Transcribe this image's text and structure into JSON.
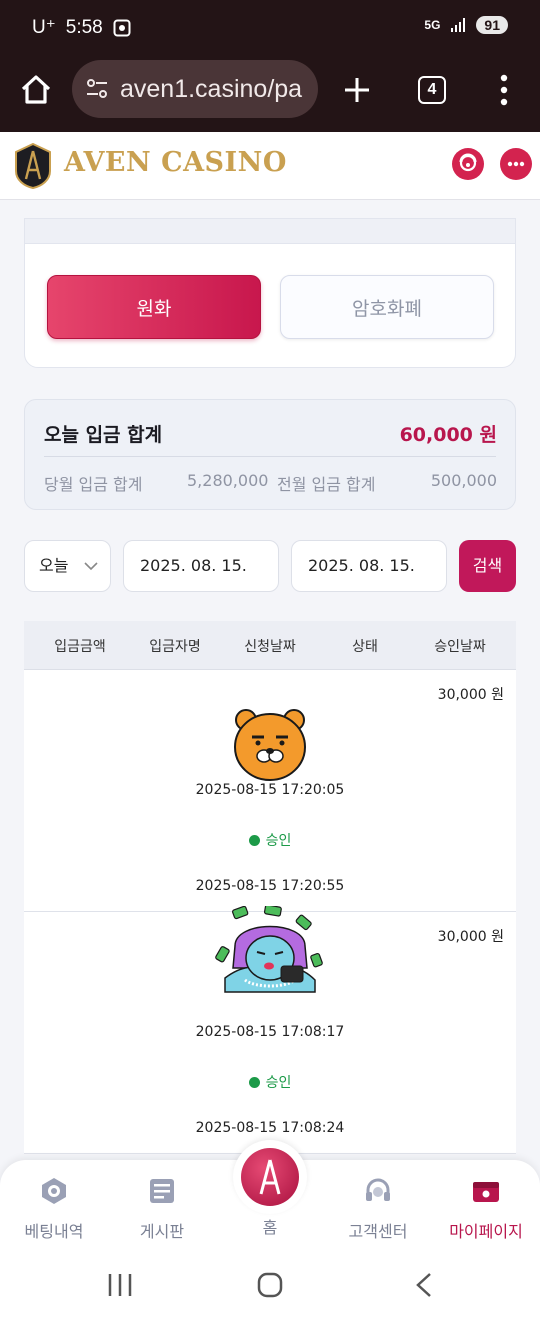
{
  "status_bar": {
    "carrier": "U⁺",
    "time": "5:58",
    "network": "5G",
    "battery": "91"
  },
  "browser": {
    "url": "aven1.casino/pa",
    "tab_count": "4"
  },
  "header": {
    "logo_text": "AVEN CASINO"
  },
  "currency_tabs": {
    "won_label": "원화",
    "crypto_label": "암호화폐",
    "active": "won"
  },
  "summary": {
    "today_label": "오늘 입금 합계",
    "today_amount": "60,000 원",
    "month_label": "당월 입금 합계",
    "month_amount": "5,280,000",
    "prev_month_label": "전월 입금 합계",
    "prev_month_amount": "500,000"
  },
  "filter": {
    "period_value": "오늘",
    "start_date": "2025. 08. 15.",
    "end_date": "2025. 08. 15.",
    "search_label": "검색"
  },
  "table": {
    "headers": [
      "입금금액",
      "입금자명",
      "신청날짜",
      "상태",
      "승인날짜"
    ],
    "rows": [
      {
        "amount": "30,000 원",
        "avatar": "orange-bear-sticker",
        "request_date": "2025-08-15 17:20:05",
        "status": "승인",
        "approve_date": "2025-08-15 17:20:55"
      },
      {
        "amount": "30,000 원",
        "avatar": "purple-hair-money-sticker",
        "request_date": "2025-08-15 17:08:17",
        "status": "승인",
        "approve_date": "2025-08-15 17:08:24"
      }
    ]
  },
  "bottom_nav": {
    "items": [
      {
        "label": "베팅내역",
        "icon": "betting-chip-icon"
      },
      {
        "label": "게시판",
        "icon": "board-icon"
      },
      {
        "label": "홈",
        "icon": "home-logo-icon"
      },
      {
        "label": "고객센터",
        "icon": "headset-icon"
      },
      {
        "label": "마이페이지",
        "icon": "wallet-icon"
      }
    ],
    "active": "마이페이지"
  },
  "colors": {
    "accent": "#c1185a",
    "gold": "#c9a050",
    "approved": "#1c9a48"
  }
}
